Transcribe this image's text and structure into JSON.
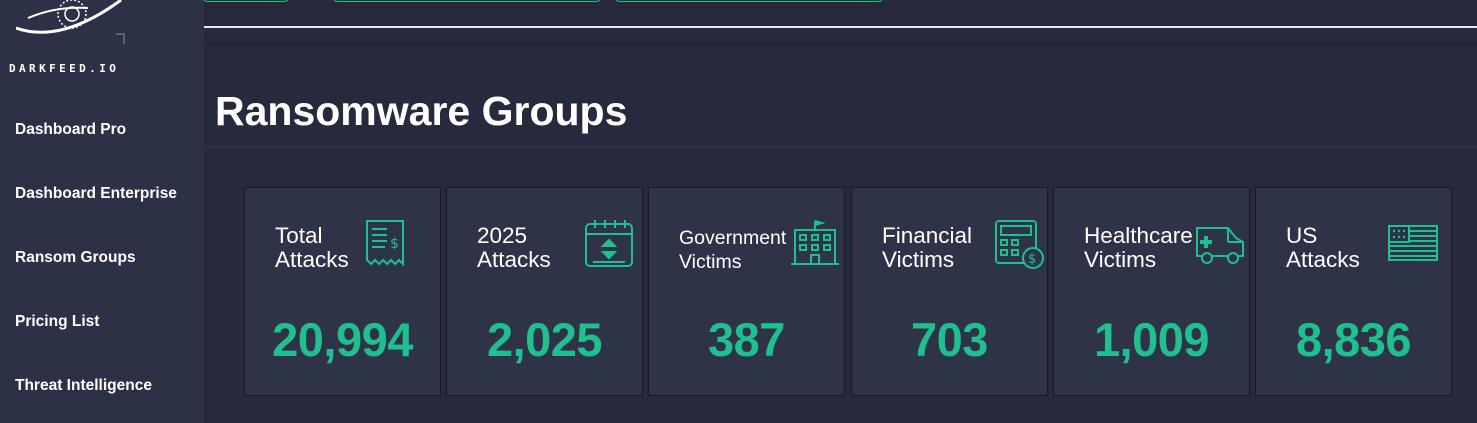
{
  "brand": {
    "logo_text": "DARKFEED.IO"
  },
  "sidebar": {
    "items": [
      {
        "label": "Dashboard Pro"
      },
      {
        "label": "Dashboard Enterprise"
      },
      {
        "label": "Ransom Groups"
      },
      {
        "label": "Pricing List"
      },
      {
        "label": "Threat Intelligence"
      }
    ]
  },
  "main": {
    "title": "Ransomware Groups",
    "cards": [
      {
        "label_line1": "Total",
        "label_line2": "Attacks",
        "value": "20,994",
        "icon": "receipt-dollar-icon"
      },
      {
        "label_line1": "2025",
        "label_line2": "Attacks",
        "value": "2,025",
        "icon": "calendar-icon"
      },
      {
        "label_line1": "Government",
        "label_line2": "Victims",
        "value": "387",
        "icon": "government-building-icon"
      },
      {
        "label_line1": "Financial",
        "label_line2": "Victims",
        "value": "703",
        "icon": "calculator-dollar-icon"
      },
      {
        "label_line1": "Healthcare",
        "label_line2": "Victims",
        "value": "1,009",
        "icon": "ambulance-icon"
      },
      {
        "label_line1": "US",
        "label_line2": "Attacks",
        "value": "8,836",
        "icon": "us-flag-icon"
      }
    ]
  },
  "colors": {
    "accent": "#1fbf8e",
    "background": "#262a3c",
    "sidebar": "#2d3146",
    "card": "#2f3348"
  }
}
